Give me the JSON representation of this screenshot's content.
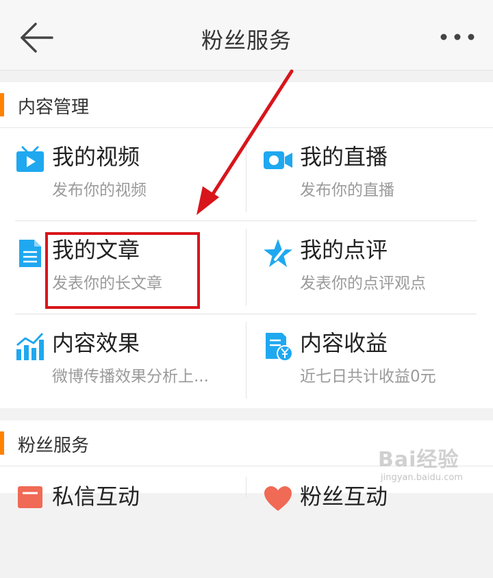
{
  "header": {
    "title": "粉丝服务",
    "back_icon": "arrow-left-icon",
    "more_icon": "more-dots-icon"
  },
  "sections": [
    {
      "title": "内容管理",
      "items": [
        {
          "title": "我的视频",
          "subtitle": "发布你的视频",
          "icon": "video-tv-icon"
        },
        {
          "title": "我的直播",
          "subtitle": "发布你的直播",
          "icon": "live-camera-icon"
        },
        {
          "title": "我的文章",
          "subtitle": "发表你的长文章",
          "icon": "article-document-icon"
        },
        {
          "title": "我的点评",
          "subtitle": "发表你的点评观点",
          "icon": "star-pen-icon"
        },
        {
          "title": "内容效果",
          "subtitle": "微博传播效果分析上...",
          "icon": "bar-chart-icon"
        },
        {
          "title": "内容收益",
          "subtitle": "近七日共计收益0元",
          "icon": "income-yuan-icon"
        }
      ]
    },
    {
      "title": "粉丝服务",
      "items": [
        {
          "title": "私信互动",
          "icon": "message-icon"
        },
        {
          "title": "粉丝互动",
          "icon": "heart-icon"
        }
      ]
    }
  ],
  "annotation": {
    "color": "#d8151b"
  },
  "watermark": {
    "brand": "Bai经验",
    "url": "jingyan.baidu.com"
  },
  "colors": {
    "accent": "#ff8200",
    "icon_blue": "#1fa8f0",
    "title": "#222222",
    "subtitle": "#9a9a9a"
  }
}
